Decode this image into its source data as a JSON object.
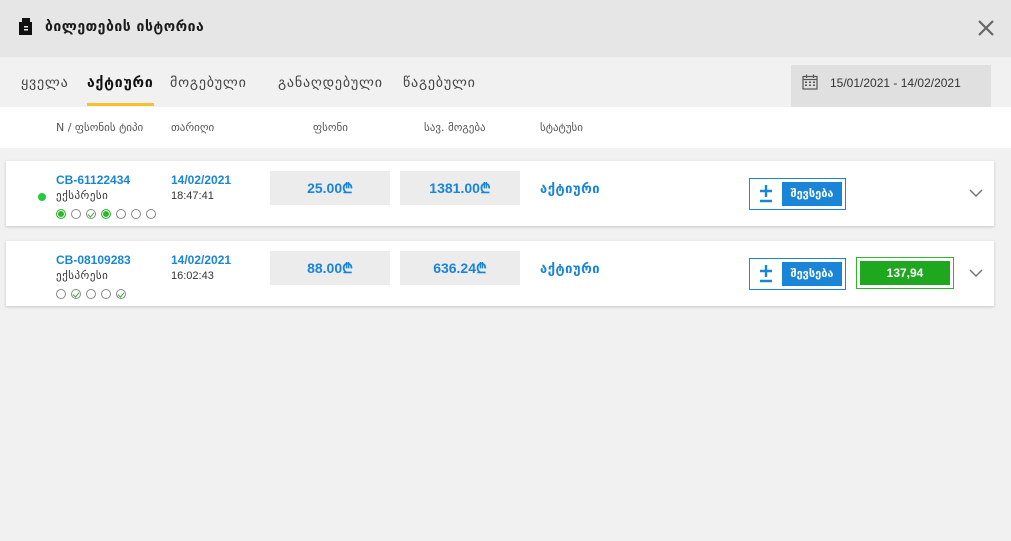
{
  "header": {
    "title": "ბილეთების ისტორია"
  },
  "tabs": [
    {
      "label": "ყველა"
    },
    {
      "label": "აქტიური"
    },
    {
      "label": "მოგებული"
    },
    {
      "label": "განაღდებული"
    },
    {
      "label": "წაგებული"
    }
  ],
  "date_range": "15/01/2021 - 14/02/2021",
  "columns": {
    "number_type": "N / ფსონის ტიპი",
    "date": "თარიღი",
    "stake": "ფსონი",
    "potential_win": "სავ. მოგება",
    "status": "სტატუსი"
  },
  "tickets": [
    {
      "id": "CB-61122434",
      "type": "ექსპრესი",
      "date": "14/02/2021",
      "time": "18:47:41",
      "stake": "25.00₾",
      "potential_win": "1381.00₾",
      "status": "აქტიური",
      "add_label": "შევსება",
      "selections": [
        "won",
        "open",
        "won-check",
        "won",
        "open",
        "open",
        "open"
      ]
    },
    {
      "id": "CB-08109283",
      "type": "ექსპრესი",
      "date": "14/02/2021",
      "time": "16:02:43",
      "stake": "88.00₾",
      "potential_win": "636.24₾",
      "status": "აქტიური",
      "add_label": "შევსება",
      "cashout": "137,94",
      "selections": [
        "open",
        "won-check",
        "open",
        "open",
        "won-check"
      ]
    }
  ],
  "colors": {
    "accent": "#1a85d6",
    "tab_underline": "#f2c230",
    "cashout": "#1fa81f",
    "active_dot": "#27c93f"
  }
}
